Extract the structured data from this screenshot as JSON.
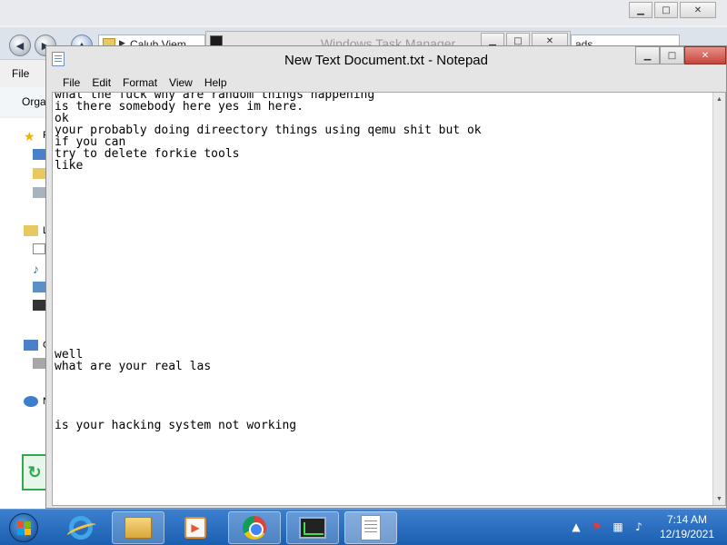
{
  "explorer": {
    "address_text": "Calub Viem",
    "search_text": "ads",
    "menu_label": "File",
    "toolbar_label": "Orga",
    "sidebar_letters": [
      "F",
      "L",
      "C",
      "N"
    ]
  },
  "task_manager": {
    "title": "Windows Task Manager"
  },
  "notepad": {
    "title": "New Text Document.txt - Notepad",
    "menu": {
      "file": "File",
      "edit": "Edit",
      "format": "Format",
      "view": "View",
      "help": "Help"
    },
    "content": "what the fuck why are random things happening\nis there somebody here yes im here.\nok\nyour probably doing direectory things using qemu shit but ok\nif you can\ntry to delete forkie tools\nlike\n\n\n\n\n\n\n\n\n\n\n\n\n\n\n\nwell\nwhat are your real las\n\n\n\n\nis your hacking system not working"
  },
  "taskbar": {
    "apps": [
      "start-button",
      "internet-explorer",
      "file-explorer",
      "media-player",
      "chrome",
      "task-manager",
      "notepad"
    ],
    "active_app": "notepad"
  },
  "clock": {
    "time": "7:14 AM",
    "date": "12/19/2021"
  },
  "tray_icons": [
    "show-hidden-icons",
    "action-center-flag-icon",
    "network-icon",
    "volume-icon"
  ]
}
